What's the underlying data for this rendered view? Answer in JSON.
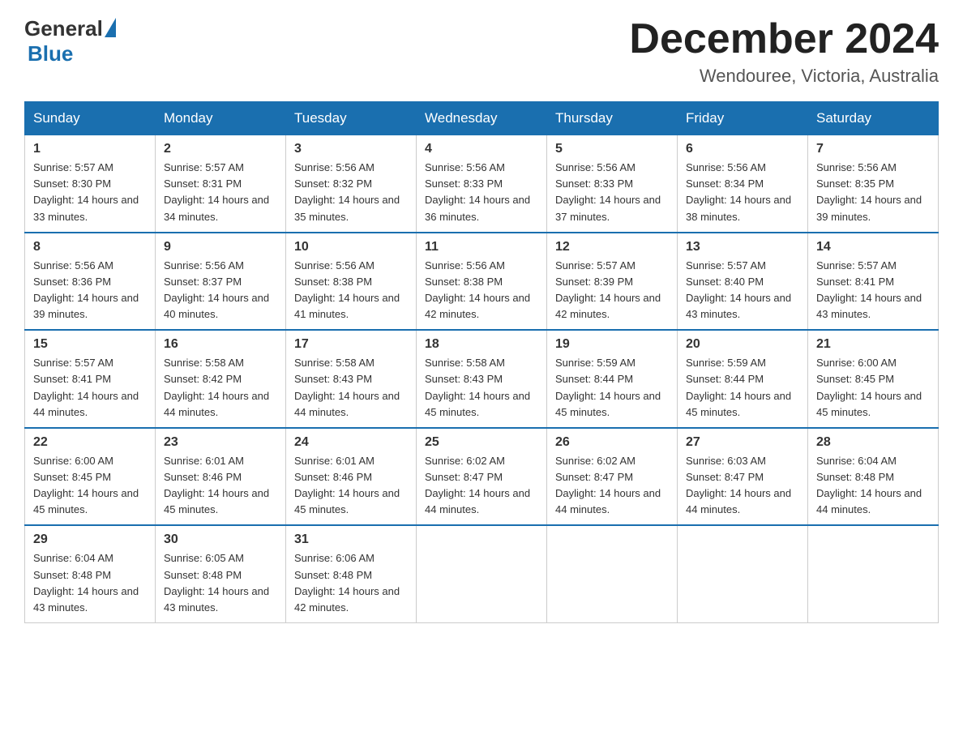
{
  "logo": {
    "general": "General",
    "blue": "Blue"
  },
  "title": {
    "month_year": "December 2024",
    "location": "Wendouree, Victoria, Australia"
  },
  "weekdays": [
    "Sunday",
    "Monday",
    "Tuesday",
    "Wednesday",
    "Thursday",
    "Friday",
    "Saturday"
  ],
  "weeks": [
    [
      {
        "day": "1",
        "sunrise": "5:57 AM",
        "sunset": "8:30 PM",
        "daylight": "14 hours and 33 minutes."
      },
      {
        "day": "2",
        "sunrise": "5:57 AM",
        "sunset": "8:31 PM",
        "daylight": "14 hours and 34 minutes."
      },
      {
        "day": "3",
        "sunrise": "5:56 AM",
        "sunset": "8:32 PM",
        "daylight": "14 hours and 35 minutes."
      },
      {
        "day": "4",
        "sunrise": "5:56 AM",
        "sunset": "8:33 PM",
        "daylight": "14 hours and 36 minutes."
      },
      {
        "day": "5",
        "sunrise": "5:56 AM",
        "sunset": "8:33 PM",
        "daylight": "14 hours and 37 minutes."
      },
      {
        "day": "6",
        "sunrise": "5:56 AM",
        "sunset": "8:34 PM",
        "daylight": "14 hours and 38 minutes."
      },
      {
        "day": "7",
        "sunrise": "5:56 AM",
        "sunset": "8:35 PM",
        "daylight": "14 hours and 39 minutes."
      }
    ],
    [
      {
        "day": "8",
        "sunrise": "5:56 AM",
        "sunset": "8:36 PM",
        "daylight": "14 hours and 39 minutes."
      },
      {
        "day": "9",
        "sunrise": "5:56 AM",
        "sunset": "8:37 PM",
        "daylight": "14 hours and 40 minutes."
      },
      {
        "day": "10",
        "sunrise": "5:56 AM",
        "sunset": "8:38 PM",
        "daylight": "14 hours and 41 minutes."
      },
      {
        "day": "11",
        "sunrise": "5:56 AM",
        "sunset": "8:38 PM",
        "daylight": "14 hours and 42 minutes."
      },
      {
        "day": "12",
        "sunrise": "5:57 AM",
        "sunset": "8:39 PM",
        "daylight": "14 hours and 42 minutes."
      },
      {
        "day": "13",
        "sunrise": "5:57 AM",
        "sunset": "8:40 PM",
        "daylight": "14 hours and 43 minutes."
      },
      {
        "day": "14",
        "sunrise": "5:57 AM",
        "sunset": "8:41 PM",
        "daylight": "14 hours and 43 minutes."
      }
    ],
    [
      {
        "day": "15",
        "sunrise": "5:57 AM",
        "sunset": "8:41 PM",
        "daylight": "14 hours and 44 minutes."
      },
      {
        "day": "16",
        "sunrise": "5:58 AM",
        "sunset": "8:42 PM",
        "daylight": "14 hours and 44 minutes."
      },
      {
        "day": "17",
        "sunrise": "5:58 AM",
        "sunset": "8:43 PM",
        "daylight": "14 hours and 44 minutes."
      },
      {
        "day": "18",
        "sunrise": "5:58 AM",
        "sunset": "8:43 PM",
        "daylight": "14 hours and 45 minutes."
      },
      {
        "day": "19",
        "sunrise": "5:59 AM",
        "sunset": "8:44 PM",
        "daylight": "14 hours and 45 minutes."
      },
      {
        "day": "20",
        "sunrise": "5:59 AM",
        "sunset": "8:44 PM",
        "daylight": "14 hours and 45 minutes."
      },
      {
        "day": "21",
        "sunrise": "6:00 AM",
        "sunset": "8:45 PM",
        "daylight": "14 hours and 45 minutes."
      }
    ],
    [
      {
        "day": "22",
        "sunrise": "6:00 AM",
        "sunset": "8:45 PM",
        "daylight": "14 hours and 45 minutes."
      },
      {
        "day": "23",
        "sunrise": "6:01 AM",
        "sunset": "8:46 PM",
        "daylight": "14 hours and 45 minutes."
      },
      {
        "day": "24",
        "sunrise": "6:01 AM",
        "sunset": "8:46 PM",
        "daylight": "14 hours and 45 minutes."
      },
      {
        "day": "25",
        "sunrise": "6:02 AM",
        "sunset": "8:47 PM",
        "daylight": "14 hours and 44 minutes."
      },
      {
        "day": "26",
        "sunrise": "6:02 AM",
        "sunset": "8:47 PM",
        "daylight": "14 hours and 44 minutes."
      },
      {
        "day": "27",
        "sunrise": "6:03 AM",
        "sunset": "8:47 PM",
        "daylight": "14 hours and 44 minutes."
      },
      {
        "day": "28",
        "sunrise": "6:04 AM",
        "sunset": "8:48 PM",
        "daylight": "14 hours and 44 minutes."
      }
    ],
    [
      {
        "day": "29",
        "sunrise": "6:04 AM",
        "sunset": "8:48 PM",
        "daylight": "14 hours and 43 minutes."
      },
      {
        "day": "30",
        "sunrise": "6:05 AM",
        "sunset": "8:48 PM",
        "daylight": "14 hours and 43 minutes."
      },
      {
        "day": "31",
        "sunrise": "6:06 AM",
        "sunset": "8:48 PM",
        "daylight": "14 hours and 42 minutes."
      },
      null,
      null,
      null,
      null
    ]
  ]
}
